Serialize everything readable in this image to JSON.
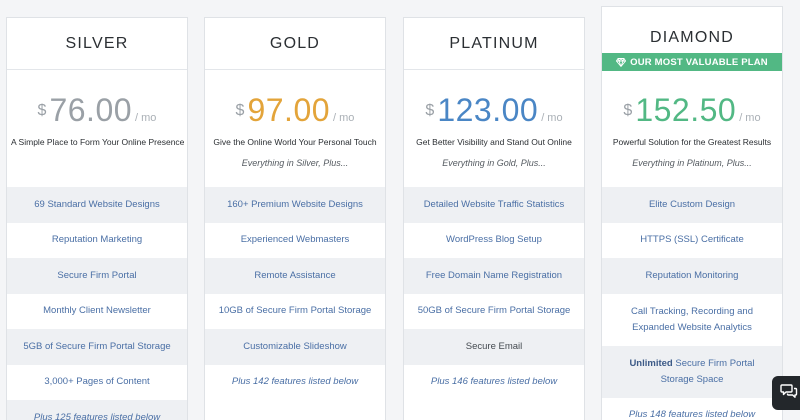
{
  "accent_colors": {
    "silver": "#9aa0a6",
    "gold": "#e3a43a",
    "platinum": "#4a86c5",
    "diamond": "#52b884",
    "feature_link": "#4a6fa5"
  },
  "plans": [
    {
      "name": "SILVER",
      "currency": "$",
      "amount": "76.00",
      "per": "/ mo",
      "tagline": "A Simple Place to Form Your Online Presence",
      "features": [
        "69 Standard Website Designs",
        "Reputation Marketing",
        "Secure Firm Portal",
        "Monthly Client Newsletter",
        "5GB of Secure Firm Portal Storage",
        "3,000+ Pages of Content",
        "Plus 125 features listed below"
      ]
    },
    {
      "name": "GOLD",
      "currency": "$",
      "amount": "97.00",
      "per": "/ mo",
      "tagline": "Give the Online World Your Personal Touch",
      "subline": "Everything in Silver, Plus...",
      "features": [
        "160+ Premium Website Designs",
        "Experienced Webmasters",
        "Remote Assistance",
        "10GB of Secure Firm Portal Storage",
        "Customizable Slideshow",
        "Plus 142 features listed below"
      ]
    },
    {
      "name": "PLATINUM",
      "currency": "$",
      "amount": "123.00",
      "per": "/ mo",
      "tagline": "Get Better Visibility and Stand Out Online",
      "subline": "Everything in Gold, Plus...",
      "features": [
        "Detailed Website Traffic Statistics",
        "WordPress Blog Setup",
        "Free Domain Name Registration",
        "50GB of Secure Firm Portal Storage",
        "Secure Email",
        "Plus 146 features listed below"
      ]
    },
    {
      "name": "DIAMOND",
      "badge": "OUR MOST VALUABLE PLAN",
      "badge_icon": "diamond-icon",
      "currency": "$",
      "amount": "152.50",
      "per": "/ mo",
      "tagline": "Powerful Solution for the Greatest Results",
      "subline": "Everything in Platinum, Plus...",
      "features": [
        "Elite Custom Design",
        "HTTPS (SSL) Certificate",
        "Reputation Monitoring",
        "Call Tracking, Recording and Expanded Website Analytics",
        {
          "strong": "Unlimited",
          "rest": " Secure Firm Portal Storage Space"
        },
        "Plus 148 features listed below"
      ]
    }
  ],
  "chat_icon": "chat-bubbles-icon"
}
